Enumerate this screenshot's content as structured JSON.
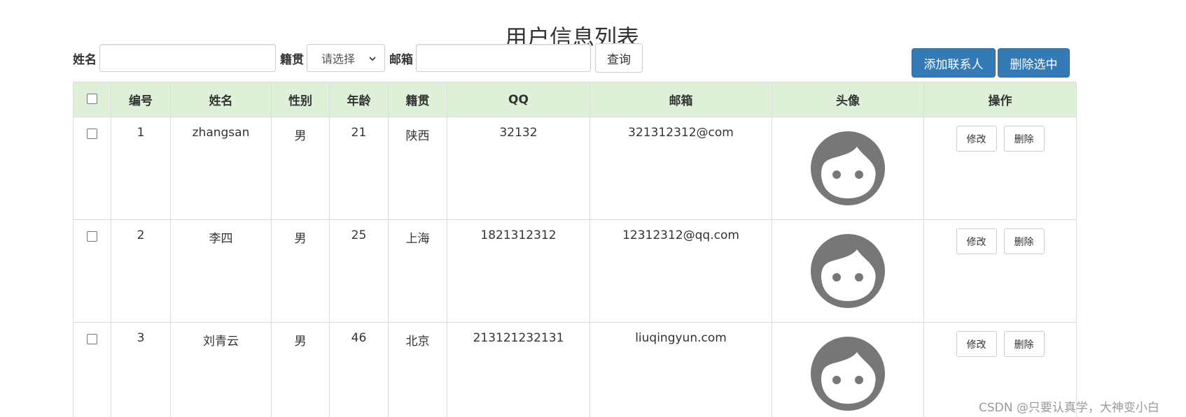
{
  "page_title": "用户信息列表",
  "search": {
    "name_label": "姓名",
    "name_value": "",
    "native_label": "籍贯",
    "native_select_value": "请选择",
    "email_label": "邮箱",
    "email_value": "",
    "query_label": "查询"
  },
  "toolbar": {
    "add_label": "添加联系人",
    "delete_selected_label": "删除选中"
  },
  "table": {
    "headers": [
      "编号",
      "姓名",
      "性别",
      "年龄",
      "籍贯",
      "QQ",
      "邮箱",
      "头像",
      "操作"
    ],
    "rows": [
      {
        "id": "1",
        "name": "zhangsan",
        "gender": "男",
        "age": "21",
        "native": "陕西",
        "qq": "32132",
        "email": "321312312@com",
        "edit_label": "修改",
        "delete_label": "删除"
      },
      {
        "id": "2",
        "name": "李四",
        "gender": "男",
        "age": "25",
        "native": "上海",
        "qq": "1821312312",
        "email": "12312312@qq.com",
        "edit_label": "修改",
        "delete_label": "删除"
      },
      {
        "id": "3",
        "name": "刘青云",
        "gender": "男",
        "age": "46",
        "native": "北京",
        "qq": "213121232131",
        "email": "liuqingyun.com",
        "edit_label": "修改",
        "delete_label": "删除"
      }
    ]
  },
  "watermark": "CSDN @只要认真学，大神变小白",
  "colors": {
    "header_bg": "#dff0d8",
    "primary": "#337ab7",
    "avatar": "#777777"
  },
  "icons": {
    "avatar": "user-face-icon",
    "select": "chevron-down-icon",
    "checkbox": "checkbox-icon"
  }
}
